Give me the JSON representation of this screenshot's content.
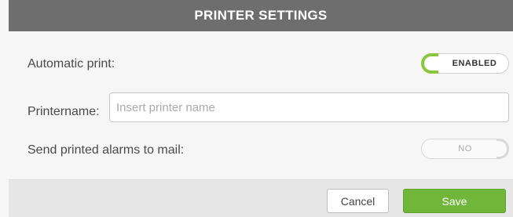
{
  "dialog": {
    "title": "PRINTER SETTINGS"
  },
  "automatic_print": {
    "label": "Automatic print:",
    "state": "ENABLED"
  },
  "printer_name": {
    "label": "Printername:",
    "value": "",
    "placeholder": "Insert printer name"
  },
  "send_alarms": {
    "label": "Send printed alarms to mail:",
    "state": "NO"
  },
  "footer": {
    "cancel_label": "Cancel",
    "save_label": "Save"
  },
  "colors": {
    "title_bar": "#6e6e6e",
    "accent_green": "#8cc63f",
    "save_green": "#6fb63a"
  }
}
